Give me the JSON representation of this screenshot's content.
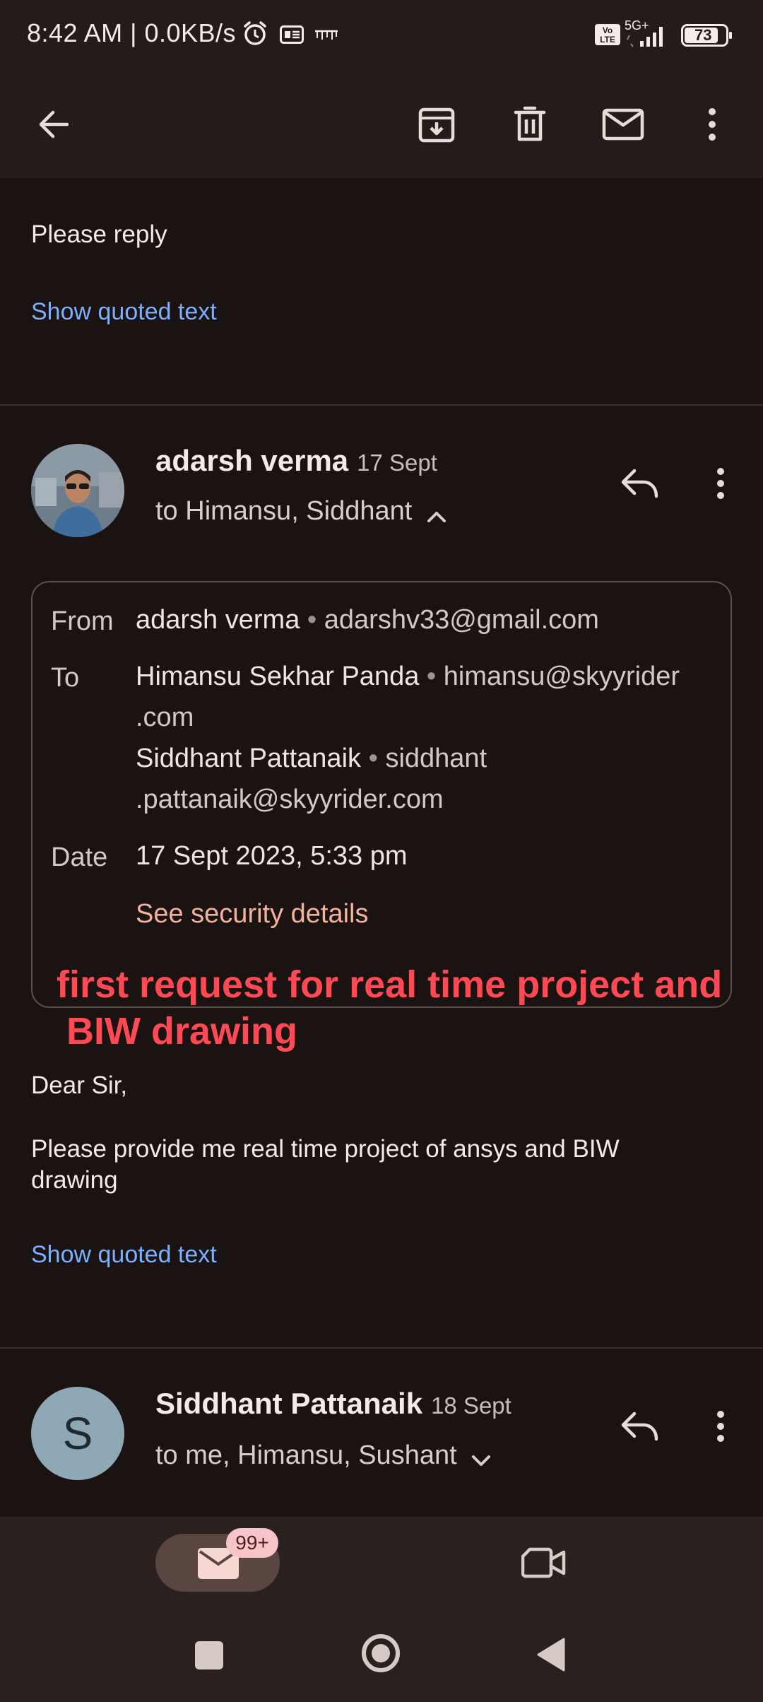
{
  "status_bar": {
    "time_speed": "8:42 AM | 0.0KB/s",
    "network": "5G+",
    "volte": "Vo LTE",
    "battery": "73",
    "icons": [
      "alarm-icon",
      "gallery-notification-icon",
      "jagran-notification-icon",
      "volte-icon",
      "signal-icon",
      "battery-icon"
    ]
  },
  "toolbar": {
    "icons": [
      "back-arrow-icon",
      "archive-icon",
      "delete-icon",
      "mark-unread-icon",
      "more-vert-icon"
    ]
  },
  "message1": {
    "body": "Please reply",
    "show_quoted": "Show quoted text"
  },
  "message2": {
    "sender": "adarsh verma",
    "date": "17 Sept",
    "recipients": "to Himansu, Siddhant",
    "details": {
      "from_label": "From",
      "from_name": "adarsh verma",
      "from_email": "adarshv33@gmail.com",
      "to_label": "To",
      "to_1_name": "Himansu Sekhar Panda",
      "to_1_email_a": "himansu@skyyrider",
      "to_1_email_b": ".com",
      "to_2_name": "Siddhant Pattanaik",
      "to_2_email_a": "siddhant",
      "to_2_email_b": ".pattanaik@skyyrider.com",
      "date_label": "Date",
      "date_value": "17 Sept 2023, 5:33 pm",
      "security_link": "See security details"
    },
    "annotation_line1": "first request for real time project and",
    "annotation_line2": "BIW drawing",
    "greeting": "Dear Sir,",
    "body_line1": "Please provide me real time project of ansys and BIW",
    "body_line2": "drawing",
    "show_quoted": "Show quoted text"
  },
  "message3": {
    "avatar_letter": "S",
    "sender": "Siddhant Pattanaik",
    "date": "18 Sept",
    "recipients": "to me, Himansu, Sushant"
  },
  "bottom_nav": {
    "mail_badge": "99+"
  },
  "colors": {
    "background": "#1b1312",
    "toolbar": "#251c1a",
    "link": "#7ab0ff",
    "security_link": "#f2b29e",
    "annotation": "#ff4a55",
    "badge": "#f7c5c9"
  }
}
